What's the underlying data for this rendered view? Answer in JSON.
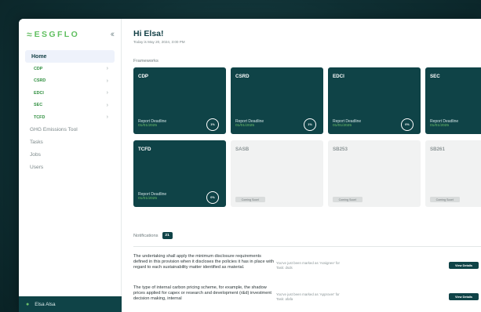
{
  "brand": {
    "logo_text": "ESGFLO",
    "accent": "#6cc06a",
    "primary": "#0f4347"
  },
  "sidebar": {
    "collapse_icon": "double-chevron-left-icon",
    "home_label": "Home",
    "frameworks": [
      {
        "label": "CDP"
      },
      {
        "label": "CSRD"
      },
      {
        "label": "EDCI"
      },
      {
        "label": "SEC"
      },
      {
        "label": "TCFD"
      }
    ],
    "items": [
      {
        "label": "GHG Emissions Tool"
      },
      {
        "label": "Tasks"
      },
      {
        "label": "Jobs"
      },
      {
        "label": "Users"
      }
    ],
    "user_name": "Elsa Alsa"
  },
  "header": {
    "greeting": "Hi Elsa!",
    "date": "Today is May 20, 2024, 3:00 PM"
  },
  "frameworks": {
    "section_label": "Frameworks",
    "deadline_label": "Report Deadline",
    "coming_soon_label": "Coming Soon!",
    "cards": [
      {
        "name": "CDP",
        "deadline": "01/01/2025",
        "progress": "1%"
      },
      {
        "name": "CSRD",
        "deadline": "01/01/2025",
        "progress": "1%"
      },
      {
        "name": "EDCI",
        "deadline": "01/01/2025",
        "progress": "0%"
      },
      {
        "name": "SEC",
        "deadline": "01/01/2025"
      },
      {
        "name": "TCFD",
        "deadline": "01/01/2025",
        "progress": "0%"
      },
      {
        "name": "SASB"
      },
      {
        "name": "SB253"
      },
      {
        "name": "SB261"
      }
    ]
  },
  "notifications": {
    "label": "Notifications",
    "count": "21",
    "button_label": "View Details",
    "items": [
      {
        "text": "The undertaking shall apply the minimum disclosure requirements defined in this provision when it discloses the policies it has in place with regard to each sustainability matter identified as material.",
        "meta_line1": "You've just been marked as 'Assignee' for",
        "meta_line2": "Task: dsds"
      },
      {
        "text": "The type of internal carbon pricing scheme, for example, the shadow prices applied for capex or research and development (r&d) investment decision making, internal",
        "meta_line1": "You've just been marked as 'Approver' for",
        "meta_line2": "Task: afafa"
      }
    ]
  }
}
